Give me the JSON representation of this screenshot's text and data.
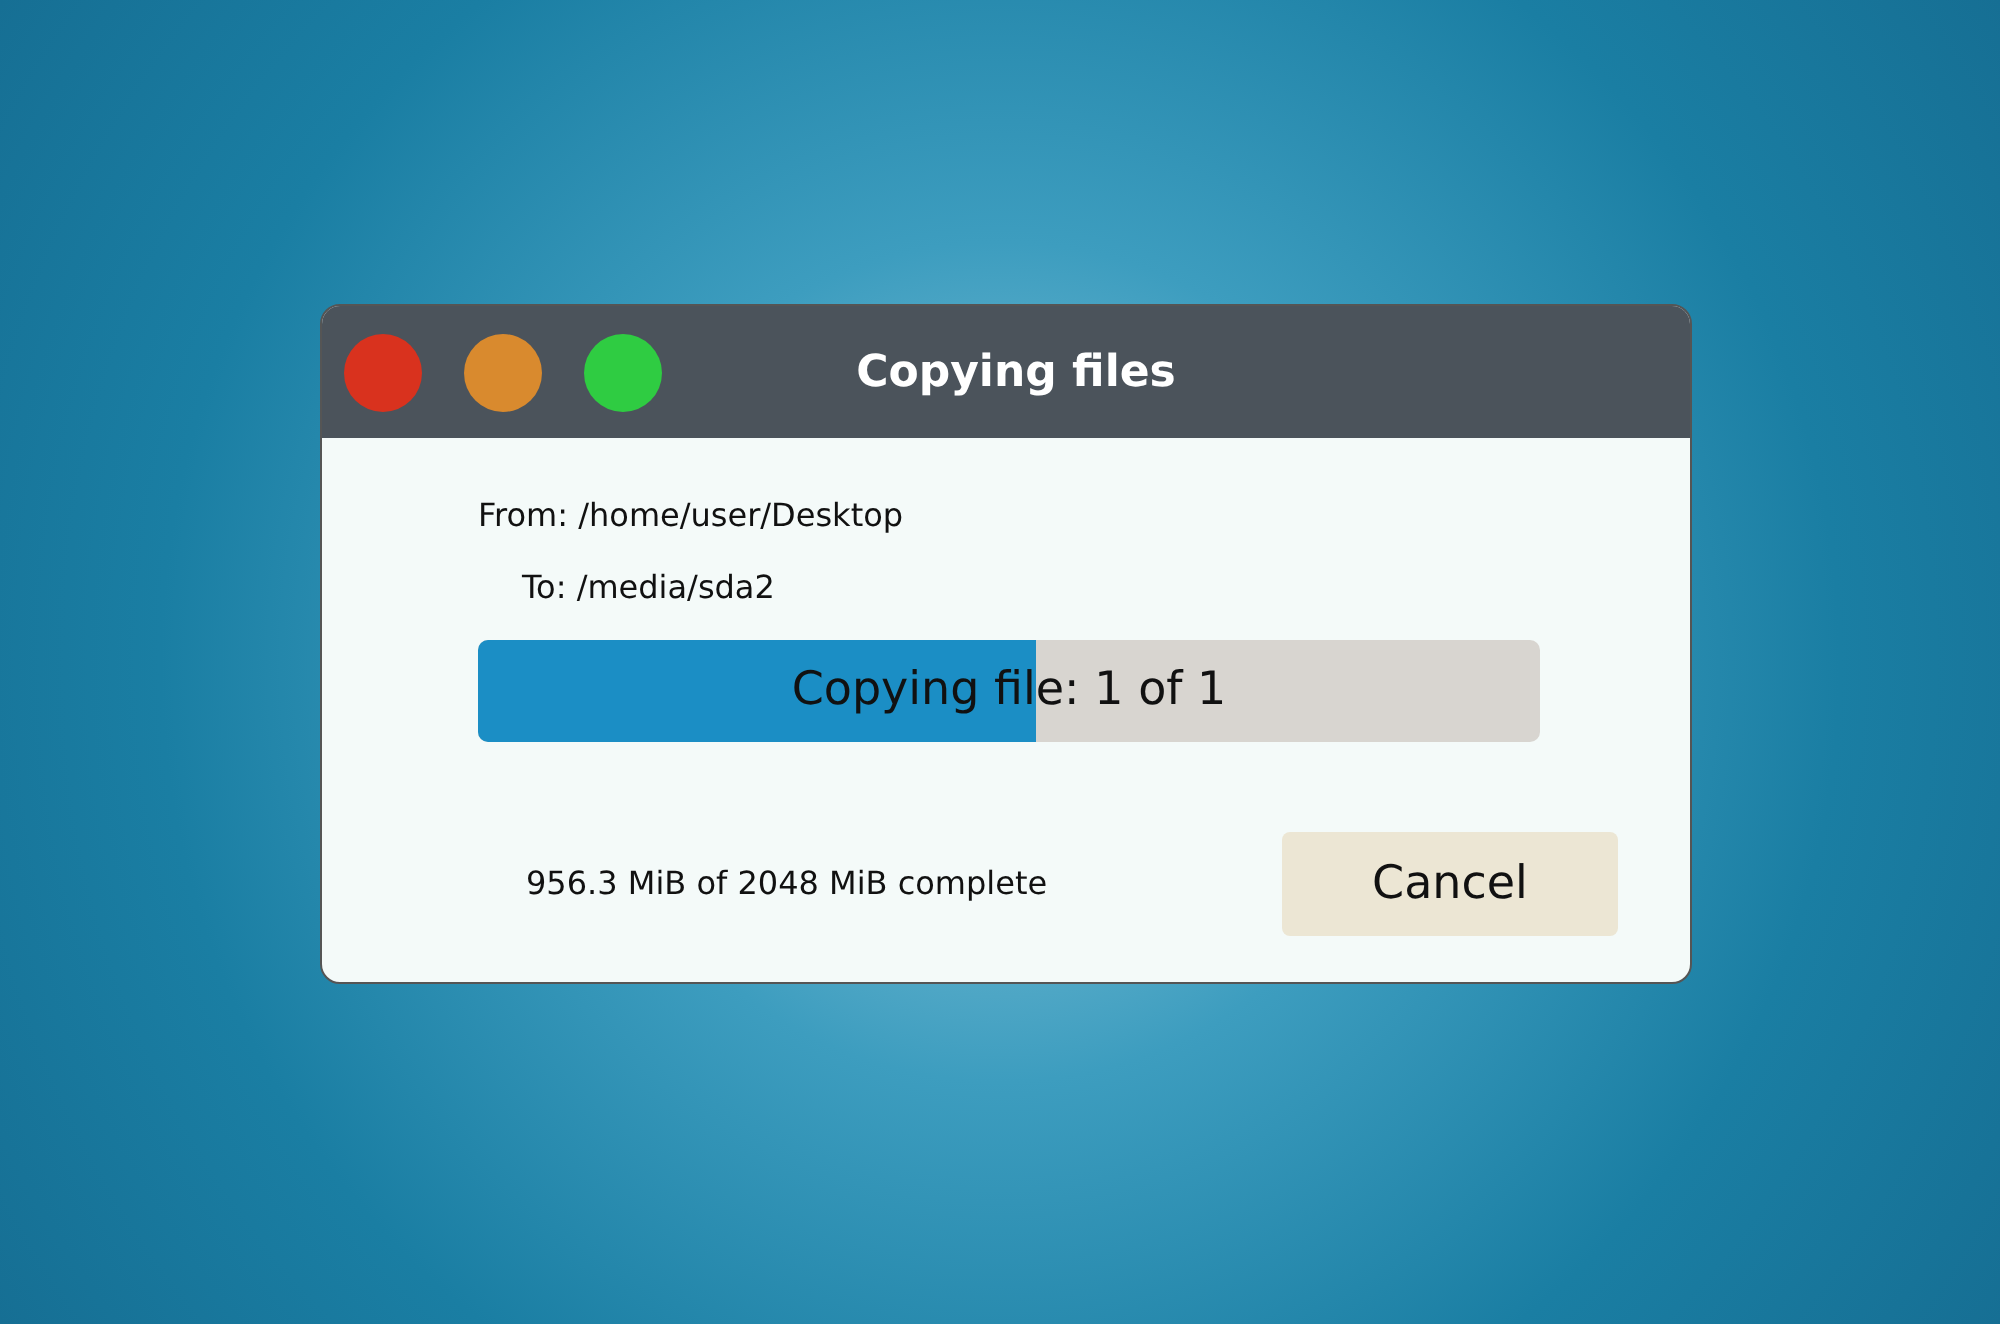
{
  "window": {
    "title": "Copying files"
  },
  "from": "From: /home/user/Desktop",
  "to": "To: /media/sda2",
  "progress": {
    "label": "Copying file: 1 of 1",
    "level": 0.525
  },
  "status": "956.3 MiB of 2048 MiB complete",
  "buttons": [
    {
      "label": "Cancel"
    }
  ]
}
